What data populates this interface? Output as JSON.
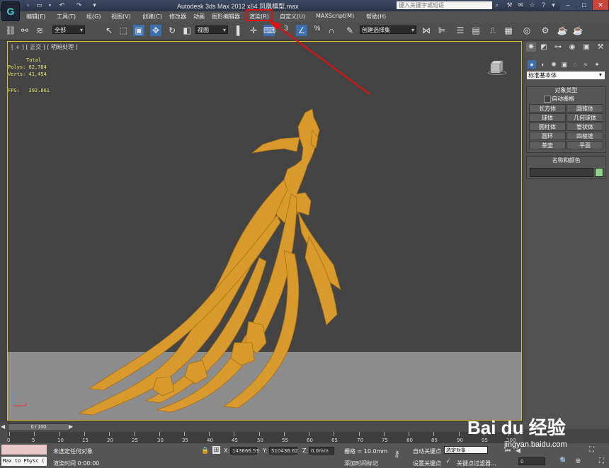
{
  "window": {
    "title": "Autodesk 3ds Max  2012 x64      凤凰模型.max",
    "search_placeholder": "键入关键字或短语",
    "controls": [
      "–",
      "□",
      "✕"
    ]
  },
  "menu": [
    {
      "label": "编辑(E)"
    },
    {
      "label": "工具(T)"
    },
    {
      "label": "组(G)"
    },
    {
      "label": "视图(V)"
    },
    {
      "label": "创建(C)"
    },
    {
      "label": "修改器"
    },
    {
      "label": "动画"
    },
    {
      "label": "图形编辑器"
    },
    {
      "label": "渲染(R)"
    },
    {
      "label": "自定义(U)"
    },
    {
      "label": "MAXScript(M)"
    },
    {
      "label": "帮助(H)"
    }
  ],
  "toolbar": {
    "selection_filter": "全部",
    "reference_coord": "视图",
    "named_selection": "创建选择集",
    "snap_number": "3",
    "snap_extra": "%"
  },
  "viewport": {
    "label": "[ + ] [ 正交 ] [ 明暗处理 ]",
    "stats_total": "Total",
    "stats_polys": "Polys: 82,784",
    "stats_verts": "Verts: 41,454",
    "stats_fps": "FPS:   292.861"
  },
  "command_panel": {
    "dropdown": "标准基本体",
    "object_type_title": "对象类型",
    "autogrid_label": "自动栅格",
    "buttons": [
      {
        "label": "长方体"
      },
      {
        "label": "圆锥体"
      },
      {
        "label": "球体"
      },
      {
        "label": "几何球体"
      },
      {
        "label": "圆柱体"
      },
      {
        "label": "管状体"
      },
      {
        "label": "圆环"
      },
      {
        "label": "四棱锥"
      },
      {
        "label": "茶壶"
      },
      {
        "label": "平面"
      }
    ],
    "name_color_title": "名称和颜色",
    "swatch_color": "#8fd68a"
  },
  "timeline": {
    "frame": "0 / 100",
    "ticks": [
      "0",
      "5",
      "10",
      "15",
      "20",
      "25",
      "30",
      "35",
      "40",
      "45",
      "50",
      "55",
      "60",
      "65",
      "70",
      "75",
      "80",
      "85",
      "90",
      "95",
      "100"
    ]
  },
  "status": {
    "script_button": "Max to Physc (",
    "selection_msg": "未选定任何对象",
    "render_time": "渲染时间  0:00:00",
    "x_label": "X:",
    "x_value": "143666.53",
    "y_label": "Y:",
    "y_value": "510436.62",
    "z_label": "Z:",
    "z_value": "0.0mm",
    "grid": "栅格 = 10.0mm",
    "add_time_tag": "添加时间标记",
    "auto_key": "自动关键点",
    "set_key": "设置关键点",
    "selected_object": "选定对象",
    "key_filters": "关键点过滤器...",
    "frame_field": "0",
    "watermark": "Bai du 经验",
    "watermark_url": "jingyan.baidu.com"
  },
  "colors": {
    "accent_red": "#e01010",
    "viewport_border": "#d8c12a",
    "model_gold": "#d89a2c",
    "stats_yellow": "#e3e36a"
  }
}
